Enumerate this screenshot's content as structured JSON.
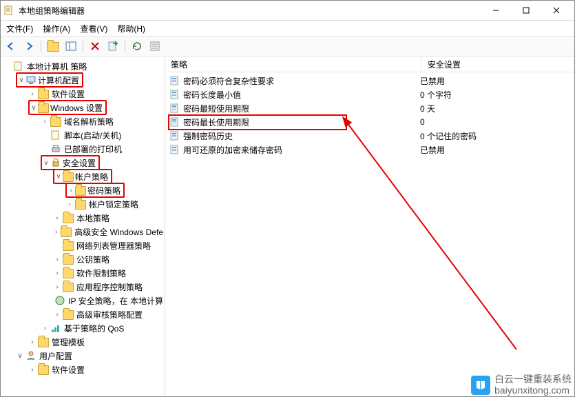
{
  "window": {
    "title": "本地组策略编辑器"
  },
  "menu": [
    "文件(F)",
    "操作(A)",
    "查看(V)",
    "帮助(H)"
  ],
  "tree": {
    "root": "本地计算机 策略",
    "computer": "计算机配置",
    "soft1": "软件设置",
    "winset": "Windows 设置",
    "dns": "域名解析策略",
    "scripts": "脚本(启动/关机)",
    "printers": "已部署的打印机",
    "secset": "安全设置",
    "acct": "帐户策略",
    "pwd": "密码策略",
    "lock": "帐户锁定策略",
    "local": "本地策略",
    "defender": "高级安全 Windows Defe",
    "netlist": "网络列表管理器策略",
    "pubkey": "公钥策略",
    "softrestrict": "软件限制策略",
    "appctrl": "应用程序控制策略",
    "ipsec": "IP 安全策略，在 本地计算",
    "audit": "高级审核策略配置",
    "qos": "基于策略的 QoS",
    "admintpl": "管理模板",
    "user": "用户配置",
    "soft2": "软件设置"
  },
  "columns": [
    "策略",
    "安全设置"
  ],
  "policies": [
    {
      "name": "密码必须符合复杂性要求",
      "val": "已禁用"
    },
    {
      "name": "密码长度最小值",
      "val": "0 个字符"
    },
    {
      "name": "密码最短使用期限",
      "val": "0 天"
    },
    {
      "name": "密码最长使用期限",
      "val": "0"
    },
    {
      "name": "强制密码历史",
      "val": "0 个记住的密码"
    },
    {
      "name": "用可还原的加密来储存密码",
      "val": "已禁用"
    }
  ],
  "watermark": "白云一键重装系统\nbaiyunxitong.com"
}
